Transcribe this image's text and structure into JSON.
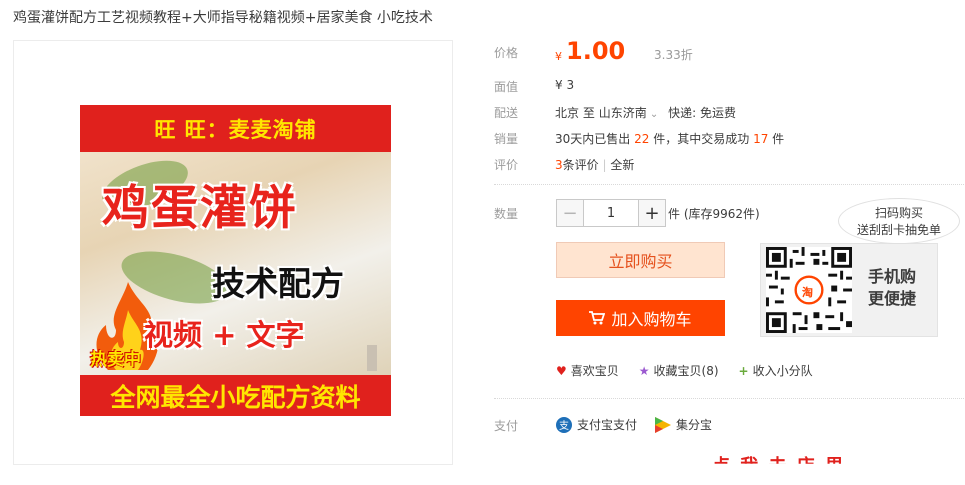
{
  "title": "鸡蛋灌饼配方工艺视频教程+大师指导秘籍视频+居家美食 小吃技术",
  "poster": {
    "shop_banner": "旺 旺：麦麦淘铺",
    "headline": "鸡蛋灌饼",
    "subline": "技术配方",
    "media_line": "视频 + 文字",
    "hot_tag": "热卖中",
    "bottom_banner": "全网最全小吃配方资料"
  },
  "price": {
    "label": "价格",
    "symbol": "¥",
    "value": "1.00",
    "discount": "3.33折"
  },
  "face_value": {
    "label": "面值",
    "value": "¥ 3"
  },
  "shipping": {
    "label": "配送",
    "from": "北京",
    "to_word": "至",
    "to": "山东济南",
    "express": "快递: 免运费"
  },
  "sales": {
    "label": "销量",
    "prefix": "30天内已售出",
    "sold": "22",
    "mid": "件，其中交易成功",
    "success": "17",
    "suffix": "件"
  },
  "reviews": {
    "label": "评价",
    "count": "3",
    "count_suffix": "条评价",
    "sep": "|",
    "all": "全新"
  },
  "quantity": {
    "label": "数量",
    "minus": "−",
    "value": "1",
    "plus": "+",
    "stock": "件 (库存9962件)"
  },
  "buttons": {
    "buy_now": "立即购买",
    "add_cart": "加入购物车"
  },
  "actions": [
    {
      "icon": "heart-icon",
      "glyph": "♥",
      "color": "#e0211d",
      "label": "喜欢宝贝"
    },
    {
      "icon": "star-icon",
      "glyph": "★",
      "color": "#9b59d0",
      "label": "收藏宝贝(8)"
    },
    {
      "icon": "plus-icon",
      "glyph": "+",
      "color": "#6aaa3c",
      "label": "收入小分队"
    }
  ],
  "mobile": {
    "bubble_line1": "扫码购买",
    "bubble_line2": "送刮刮卡抽免单",
    "line1": "手机购",
    "line2": "更便捷",
    "qr_badge": "淘"
  },
  "payment": {
    "label": "支付",
    "alipay": "支付宝支付",
    "jifenbao": "集分宝",
    "alipay_glyph": "支"
  },
  "cut_text": "点 我 去 店 里"
}
